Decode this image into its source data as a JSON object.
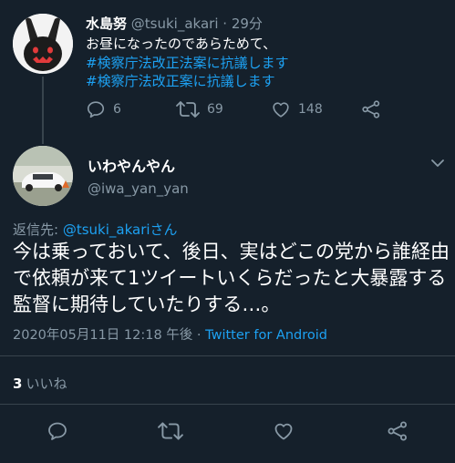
{
  "parent_tweet": {
    "author_name": "水島努",
    "handle": "@tsuki_akari",
    "time": "· 29分",
    "lines": [
      "お昼になったのであらためて、",
      "#検察庁法改正法案に抗議します",
      "#検察庁法改正案に抗議します"
    ],
    "reply_count": "6",
    "retweet_count": "69",
    "like_count": "148"
  },
  "reply_tweet": {
    "author_name": "いわやんやん",
    "handle": "@iwa_yan_yan",
    "replying_to_prefix": "返信先: ",
    "replying_to_handle": "@tsuki_akariさん",
    "text": "今は乗っておいて、後日、実はどこの党から誰経由で依頼が来て1ツイートいくらだったと大暴露する監督に期待していたりする…。",
    "timestamp": "2020年05月11日 12:18 午後",
    "separator": " · ",
    "source": "Twitter for Android",
    "likes_count": "3",
    "likes_label": "いいね"
  },
  "colors": {
    "background": "#15202b",
    "muted": "#8899a6",
    "link": "#1da1f2",
    "divider": "#38444d"
  },
  "icons": [
    "reply-icon",
    "retweet-icon",
    "like-icon",
    "share-icon",
    "chevron-down-icon"
  ]
}
